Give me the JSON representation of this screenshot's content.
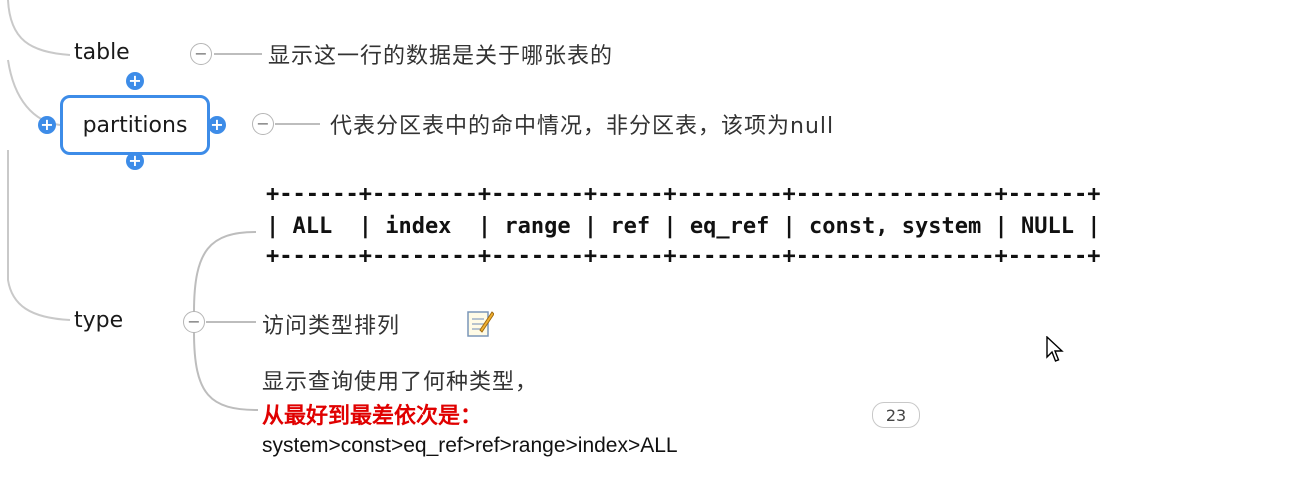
{
  "nodes": {
    "table": {
      "label": "table",
      "description": "显示这一行的数据是关于哪张表的"
    },
    "partitions": {
      "label": "partitions",
      "description": "代表分区表中的命中情况，非分区表，该项为null"
    },
    "type": {
      "label": "type",
      "join_types_table": {
        "border": "+------+--------+-------+-----+--------+---------------+------+",
        "row": "| ALL  | index  | range | ref | eq_ref | const, system | NULL |"
      },
      "note_title": "访问类型排列",
      "description_line1": "显示查询使用了何种类型，",
      "description_line2": "从最好到最差依次是：",
      "description_line3": "system>const>eq_ref>ref>range>index>ALL",
      "note_count": "23"
    }
  },
  "controls": {
    "collapse_symbol": "−",
    "add_symbol": "+"
  },
  "colors": {
    "selection": "#3d8ce8",
    "emphasis": "#e00000",
    "connector": "#bdbdbd"
  }
}
